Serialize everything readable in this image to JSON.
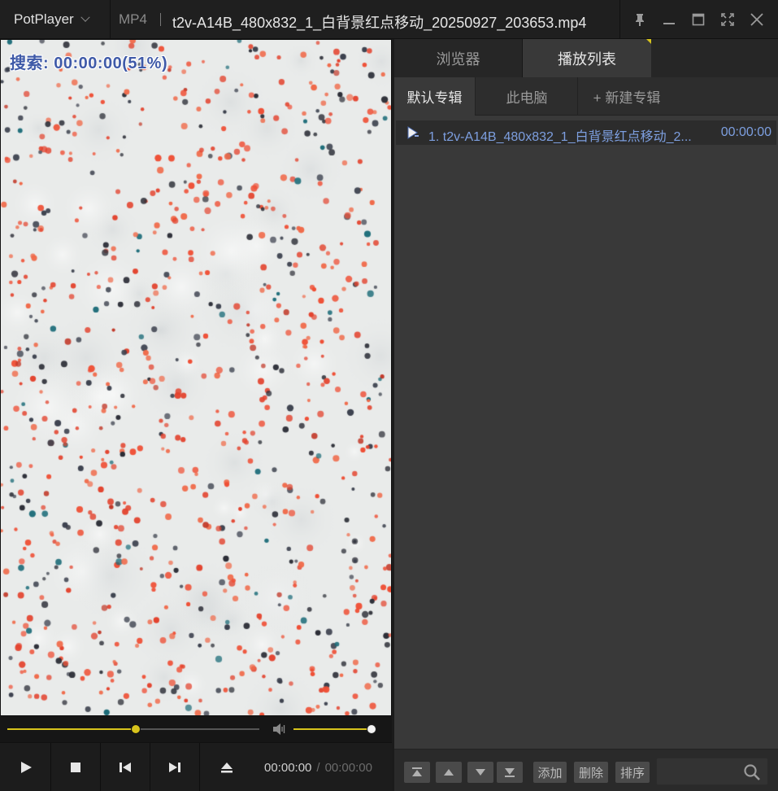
{
  "titlebar": {
    "app_name": "PotPlayer",
    "format": "MP4",
    "file_title": "t2v-A14B_480x832_1_白背景红点移动_20250927_203653.mp4",
    "icons": [
      "pin-icon",
      "minimize-icon",
      "maximize-icon",
      "fullscreen-icon",
      "close-icon"
    ]
  },
  "video": {
    "osd_text": "搜索: 00:00:00(51%)",
    "background": "#e9ebea",
    "dot_colors": [
      "#ef4f35",
      "#e3442f",
      "#f06a4a",
      "#2b2d36",
      "#3a3f4c",
      "#1b6b78",
      "#c23a2a"
    ]
  },
  "seek": {
    "position_fraction": 0.51,
    "volume_fraction": 1.0,
    "accent": "#d7c31c"
  },
  "controls": {
    "buttons": [
      "play-icon",
      "stop-icon",
      "previous-icon",
      "next-icon",
      "eject-icon"
    ],
    "current_time": "00:00:00",
    "separator": "/",
    "total_time": "00:00:00"
  },
  "panel": {
    "tabs": {
      "browser": "浏览器",
      "playlist": "播放列表"
    },
    "album_tabs": {
      "default": "默认专辑",
      "pc": "此电脑",
      "new": "+ 新建专辑"
    },
    "items": [
      {
        "name": "1. t2v-A14B_480x832_1_白背景红点移动_2...",
        "duration": "00:00:00"
      }
    ],
    "footer": {
      "icons": [
        "move-top-icon",
        "move-up-icon",
        "move-down-icon",
        "move-bottom-icon",
        "search-icon"
      ],
      "add": "添加",
      "delete": "删除",
      "sort": "排序",
      "search_placeholder": ""
    }
  }
}
